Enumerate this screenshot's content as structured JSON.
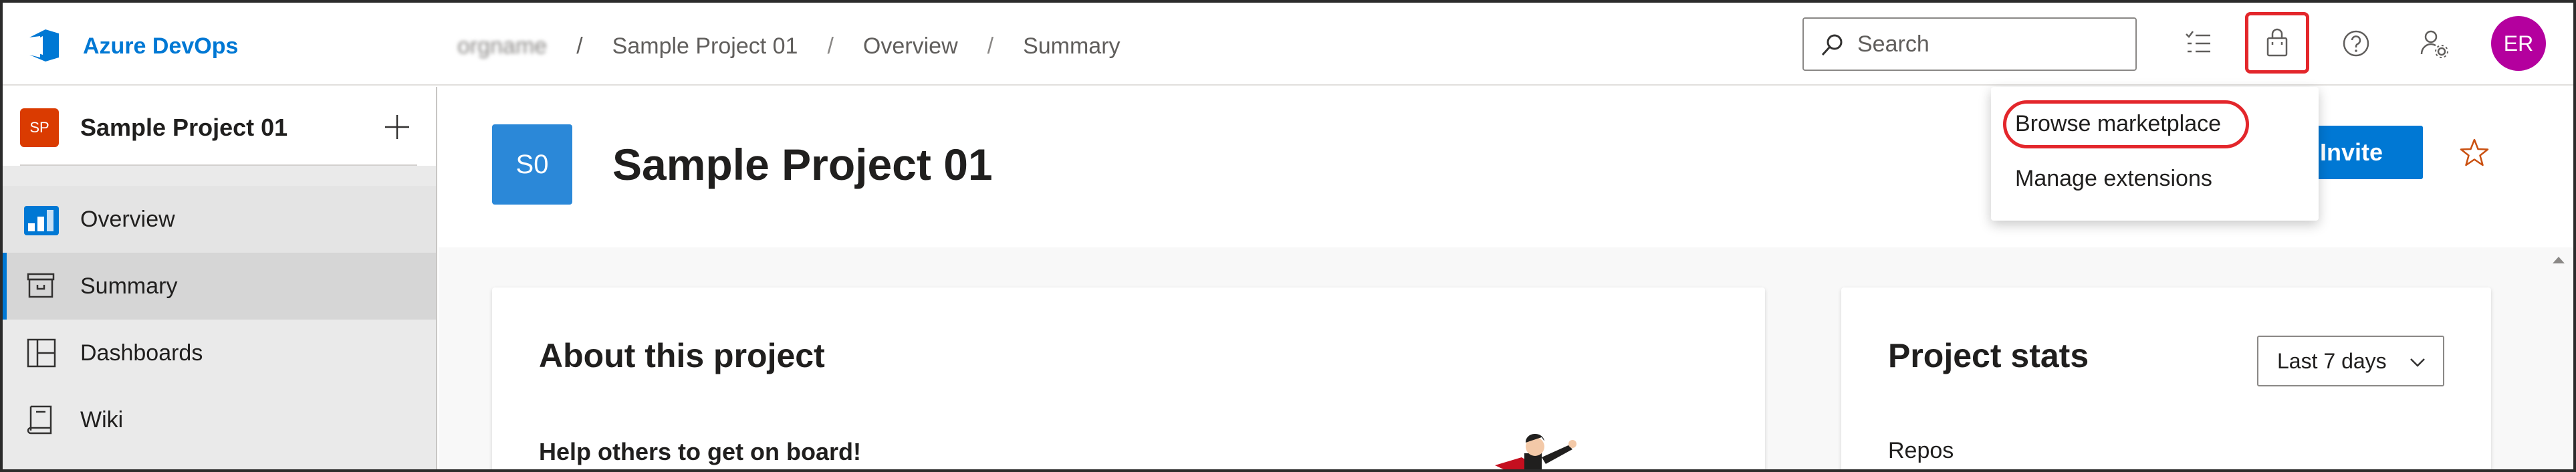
{
  "app": {
    "brand": "Azure DevOps",
    "accent": "#0078d4"
  },
  "breadcrumb": {
    "org": "orgname",
    "separator": "/",
    "project": "Sample Project 01",
    "section": "Overview",
    "page": "Summary"
  },
  "search": {
    "placeholder": "Search"
  },
  "user": {
    "initials": "ER",
    "avatar_color": "#b4009e"
  },
  "sidebar": {
    "project_badge": "SP",
    "project_name": "Sample Project 01",
    "items": [
      {
        "label": "Overview",
        "icon": "overview-icon"
      },
      {
        "label": "Summary",
        "icon": "summary-icon",
        "selected": true
      },
      {
        "label": "Dashboards",
        "icon": "dashboards-icon"
      },
      {
        "label": "Wiki",
        "icon": "wiki-icon"
      }
    ]
  },
  "header": {
    "project_initials": "S0",
    "title": "Sample Project 01",
    "invite_label": "Invite"
  },
  "about_card": {
    "title": "About this project",
    "subtitle": "Help others to get on board!"
  },
  "stats_card": {
    "title": "Project stats",
    "range": "Last 7 days",
    "first_section": "Repos"
  },
  "marketplace_menu": {
    "items": [
      {
        "label": "Browse marketplace",
        "highlighted": true
      },
      {
        "label": "Manage extensions"
      }
    ]
  },
  "annotation_color": "#e3262b"
}
